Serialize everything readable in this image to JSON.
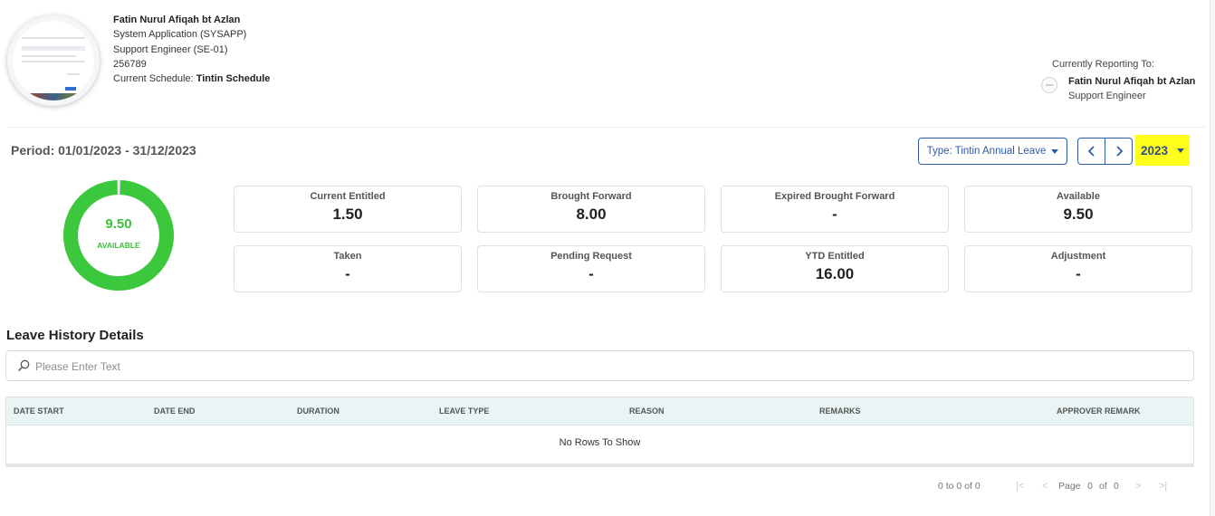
{
  "profile": {
    "name": "Fatin Nurul Afiqah bt Azlan",
    "department": "System Application (SYSAPP)",
    "position": "Support Engineer (SE-01)",
    "employee_id": "256789",
    "schedule_label": "Current Schedule:",
    "schedule_value": "Tintin Schedule"
  },
  "reporting": {
    "label": "Currently Reporting To:",
    "name": "Fatin Nurul Afiqah bt Azlan",
    "title": "Support Engineer"
  },
  "period": "Period: 01/01/2023 - 31/12/2023",
  "type_selector": "Type: Tintin Annual Leave",
  "year": "2023",
  "donut": {
    "value": "9.50",
    "label": "AVAILABLE",
    "available_fraction": 0.99,
    "color": "#3cc83c",
    "track_color": "#e8eaec"
  },
  "stats": [
    {
      "title": "Current Entitled",
      "value": "1.50"
    },
    {
      "title": "Brought Forward",
      "value": "8.00"
    },
    {
      "title": "Expired Brought Forward",
      "value": "-"
    },
    {
      "title": "Available",
      "value": "9.50"
    },
    {
      "title": "Taken",
      "value": "-"
    },
    {
      "title": "Pending Request",
      "value": "-"
    },
    {
      "title": "YTD Entitled",
      "value": "16.00"
    },
    {
      "title": "Adjustment",
      "value": "-"
    }
  ],
  "history": {
    "title": "Leave History Details",
    "search_placeholder": "Please Enter Text",
    "columns": [
      "DATE START",
      "DATE END",
      "DURATION",
      "LEAVE TYPE",
      "REASON",
      "REMARKS",
      "APPROVER REMARK"
    ],
    "empty_text": "No Rows To Show"
  },
  "pagination": {
    "summary": "0 to 0 of 0",
    "page_label": "Page",
    "current_page": "0",
    "of_label": "of",
    "total_pages": "0"
  },
  "icons": {
    "search": "search-icon",
    "prev": "chevron-left-icon",
    "next": "chevron-right-icon",
    "first": "first-page-icon",
    "last": "last-page-icon"
  }
}
